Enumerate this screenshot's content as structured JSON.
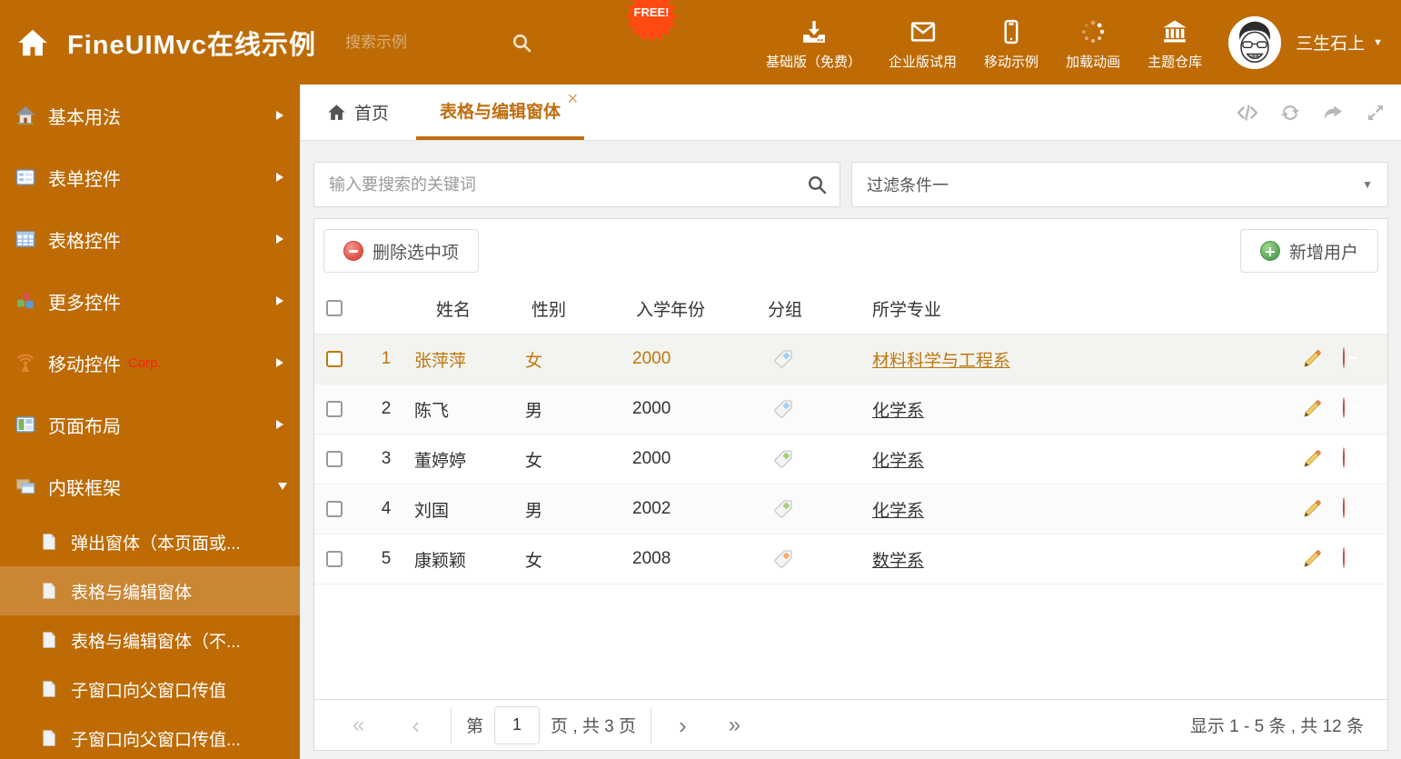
{
  "header": {
    "title": "FineUIMvc在线示例",
    "search": {
      "placeholder": "搜索示例"
    },
    "free_badge": "FREE!",
    "nav": [
      {
        "icon": "download-icon",
        "label": "基础版（免费）"
      },
      {
        "icon": "envelope-icon",
        "label": "企业版试用"
      },
      {
        "icon": "mobile-icon",
        "label": "移动示例"
      },
      {
        "icon": "spinner-icon",
        "label": "加载动画"
      },
      {
        "icon": "bank-icon",
        "label": "主题仓库"
      }
    ],
    "user": {
      "name": "三生石上"
    }
  },
  "sidebar": {
    "items": [
      {
        "icon": "home-colored-icon",
        "label": "基本用法"
      },
      {
        "icon": "form-icon",
        "label": "表单控件"
      },
      {
        "icon": "grid-icon",
        "label": "表格控件"
      },
      {
        "icon": "blocks-icon",
        "label": "更多控件"
      },
      {
        "icon": "antenna-icon",
        "label": "移动控件",
        "badge": "Corp."
      },
      {
        "icon": "layout-icon",
        "label": "页面布局"
      },
      {
        "icon": "frames-icon",
        "label": "内联框架",
        "expanded": true
      }
    ],
    "subitems": [
      {
        "label": "弹出窗体（本页面或..."
      },
      {
        "label": "表格与编辑窗体",
        "active": true
      },
      {
        "label": "表格与编辑窗体（不..."
      },
      {
        "label": "子窗口向父窗口传值"
      },
      {
        "label": "子窗口向父窗口传值..."
      }
    ]
  },
  "tabbar": {
    "tabs": [
      {
        "label": "首页",
        "icon": "home-icon"
      },
      {
        "label": "表格与编辑窗体",
        "active": true,
        "closable": true
      }
    ],
    "actions": [
      "code-icon",
      "refresh-icon",
      "share-icon",
      "expand-icon"
    ]
  },
  "filters": {
    "search_placeholder": "输入要搜索的关键词",
    "dropdown_value": "过滤条件一"
  },
  "toolbar": {
    "delete_button": "删除选中项",
    "add_button": "新增用户"
  },
  "table": {
    "columns": [
      "姓名",
      "性别",
      "入学年份",
      "分组",
      "所学专业"
    ],
    "rows": [
      {
        "num": "1",
        "name": "张萍萍",
        "gender": "女",
        "year": "2000",
        "tag_color": "#9cd0f5",
        "major": "材料科学与工程系",
        "selected": true
      },
      {
        "num": "2",
        "name": "陈飞",
        "gender": "男",
        "year": "2000",
        "tag_color": "#9cd0f5",
        "major": "化学系"
      },
      {
        "num": "3",
        "name": "董婷婷",
        "gender": "女",
        "year": "2000",
        "tag_color": "#a8cc7c",
        "major": "化学系"
      },
      {
        "num": "4",
        "name": "刘国",
        "gender": "男",
        "year": "2002",
        "tag_color": "#a8cc7c",
        "major": "化学系"
      },
      {
        "num": "5",
        "name": "康颖颖",
        "gender": "女",
        "year": "2008",
        "tag_color": "#f6ad69",
        "major": "数学系"
      }
    ]
  },
  "pagination": {
    "page_label_prefix": "第",
    "page_value": "1",
    "page_label_suffix": "页 , 共 3 页",
    "summary": "显示 1 - 5 条 , 共 12 条"
  },
  "colors": {
    "brand_orange": "#be6b05",
    "sidebar_active": "#cb8634",
    "active_tab_orange": "#bf6e0e",
    "selected_row_text": "#bf770f",
    "delete_red": "#dd5145",
    "add_green": "#55a555",
    "free_badge_red": "#ff4b12"
  }
}
